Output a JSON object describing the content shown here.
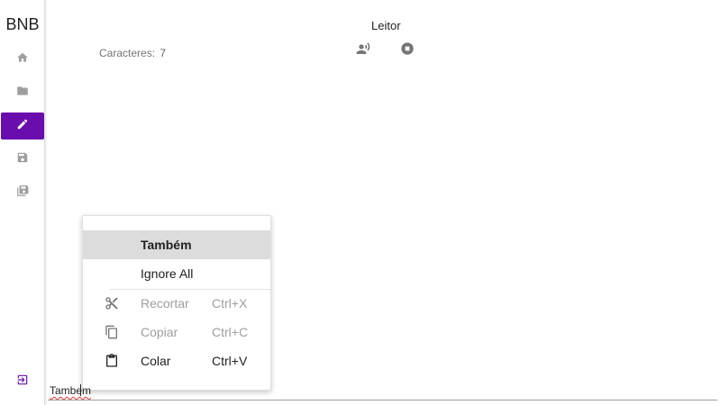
{
  "app": {
    "brand": "BNB",
    "accent_color": "#6a0dad"
  },
  "sidebar": {
    "items": [
      {
        "name": "home",
        "icon": "home-icon",
        "active": false
      },
      {
        "name": "folder",
        "icon": "folder-icon",
        "active": false
      },
      {
        "name": "edit",
        "icon": "pencil-icon",
        "active": true
      },
      {
        "name": "save",
        "icon": "save-icon",
        "active": false
      },
      {
        "name": "save-all",
        "icon": "save-all-icon",
        "active": false
      }
    ],
    "logout_icon": "logout-icon"
  },
  "header": {
    "title": "Leitor",
    "char_label": "Caracteres:",
    "char_count": "7",
    "icons": [
      "record-voice-icon",
      "stop-icon"
    ]
  },
  "editor": {
    "text": "Tambem"
  },
  "context_menu": {
    "suggestion": "Também",
    "ignore_all": "Ignore All",
    "items": [
      {
        "label": "Recortar",
        "shortcut": "Ctrl+X",
        "icon": "scissors-icon",
        "enabled": false
      },
      {
        "label": "Copiar",
        "shortcut": "Ctrl+C",
        "icon": "copy-icon",
        "enabled": false
      },
      {
        "label": "Colar",
        "shortcut": "Ctrl+V",
        "icon": "clipboard-icon",
        "enabled": true
      }
    ]
  }
}
